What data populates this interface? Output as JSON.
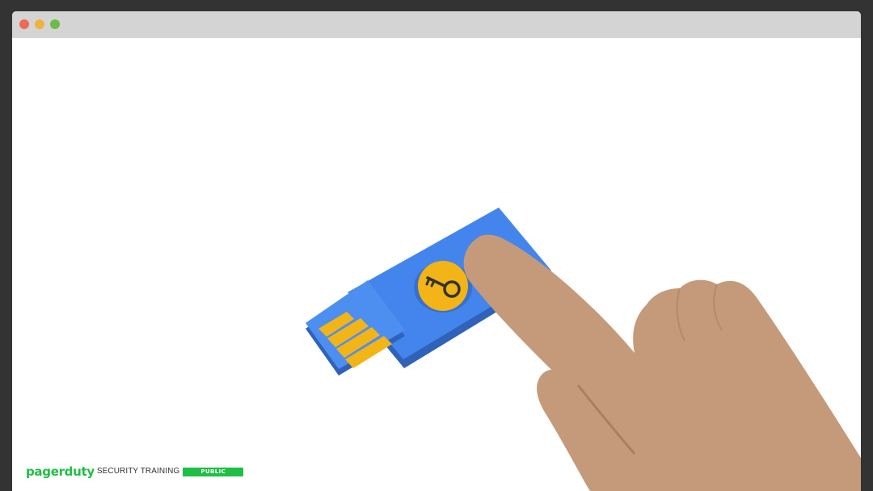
{
  "window": {
    "controls": {
      "close_color": "#ee6a55",
      "minimize_color": "#f0b43c",
      "maximize_color": "#6cbd45"
    }
  },
  "illustration": {
    "subject": [
      "usb-security-key-icon",
      "key-icon",
      "pointing-hand-icon"
    ],
    "colors": {
      "key_body": "#4385ec",
      "key_body_shadow": "#2f62b8",
      "contacts": "#f2b416",
      "button": "#f2b416",
      "hand": "#c49a7a",
      "hand_shadow": "#a87f62"
    }
  },
  "footer": {
    "brand": "pagerduty",
    "brand_color": "#1fbf45",
    "training_label": "SECURITY TRAINING",
    "badge_label": "PUBLIC",
    "badge_color": "#1fbf45"
  }
}
